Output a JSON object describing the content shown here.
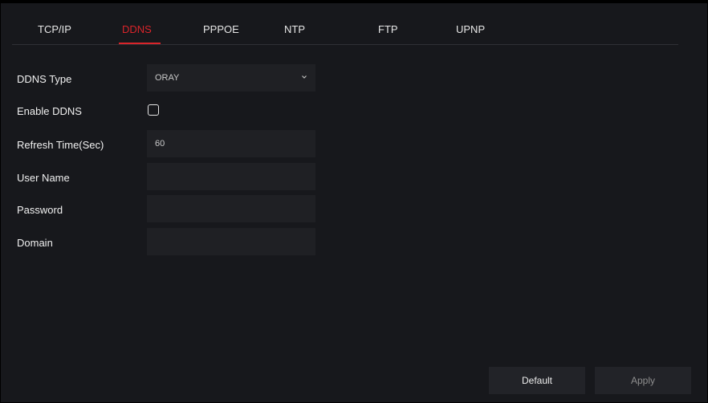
{
  "tabs": [
    {
      "label": "TCP/IP"
    },
    {
      "label": "DDNS"
    },
    {
      "label": "PPPOE"
    },
    {
      "label": "NTP"
    },
    {
      "label": "FTP"
    },
    {
      "label": "UPNP"
    }
  ],
  "active_tab": "DDNS",
  "form": {
    "ddns_type": {
      "label": "DDNS Type",
      "value": "ORAY"
    },
    "enable_ddns": {
      "label": "Enable DDNS",
      "checked": false
    },
    "refresh_time": {
      "label": "Refresh Time(Sec)",
      "value": "60"
    },
    "user_name": {
      "label": "User Name",
      "value": ""
    },
    "password": {
      "label": "Password",
      "value": ""
    },
    "domain": {
      "label": "Domain",
      "value": ""
    }
  },
  "buttons": {
    "default_label": "Default",
    "apply_label": "Apply"
  },
  "colors": {
    "background": "#17181c",
    "field": "#1f2024",
    "accent": "#d9242a",
    "text": "#f0f0f0"
  },
  "icons": {
    "select_arrow": "chevron-down-icon",
    "checkbox": "checkbox-unchecked-icon"
  }
}
